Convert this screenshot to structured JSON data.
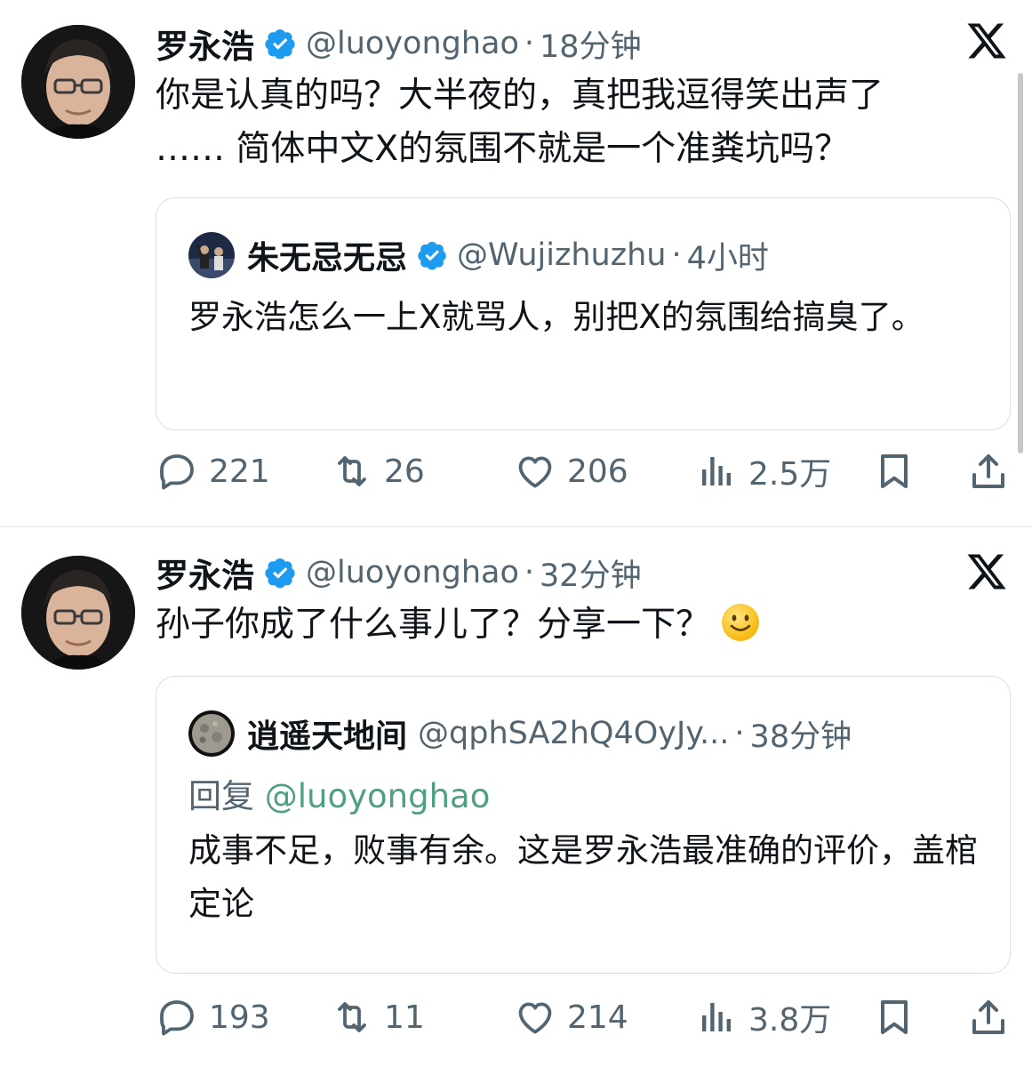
{
  "tweets": [
    {
      "author": {
        "name": "罗永浩",
        "handle": "@luoyonghao"
      },
      "time": "18分钟",
      "text": "你是认真的吗？大半夜的，真把我逗得笑出声了 …… 简体中文X的氛围不就是一个准粪坑吗？",
      "quote": {
        "author": {
          "name": "朱无忌无忌",
          "handle": "@Wujizhuzhu"
        },
        "time": "4小时",
        "reply_label": "",
        "reply_handle": "",
        "text": "罗永浩怎么一上X就骂人，别把X的氛围给搞臭了。"
      },
      "stats": {
        "replies": "221",
        "retweets": "26",
        "likes": "206",
        "views": "2.5万"
      }
    },
    {
      "author": {
        "name": "罗永浩",
        "handle": "@luoyonghao"
      },
      "time": "32分钟",
      "text": "孙子你成了什么事儿了？分享一下？",
      "emoji": "slightly-smiling-face",
      "quote": {
        "author": {
          "name": "逍遥天地间",
          "handle": "@qphSA2hQ4OyJy..."
        },
        "time": "38分钟",
        "reply_label": "回复",
        "reply_handle": "@luoyonghao",
        "text": "成事不足，败事有余。这是罗永浩最准确的评价，盖棺定论"
      },
      "stats": {
        "replies": "193",
        "retweets": "11",
        "likes": "214",
        "views": "3.8万"
      }
    }
  ],
  "separator": "·",
  "colors": {
    "text": "#0f1419",
    "secondary": "#536471",
    "verified": "#1d9bf0",
    "mention": "#4f9e86",
    "border": "#d8dde2"
  },
  "icons": [
    "verified-badge-icon",
    "x-logo-icon",
    "reply-icon",
    "retweet-icon",
    "like-icon",
    "views-icon",
    "bookmark-icon",
    "share-icon"
  ]
}
